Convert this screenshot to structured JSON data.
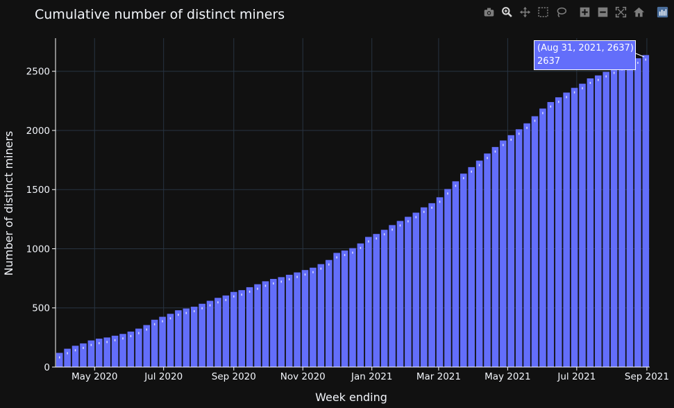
{
  "chart_data": {
    "type": "bar",
    "title": "Cumulative number of distinct miners",
    "xlabel": "Week ending",
    "ylabel": "Number of distinct miners",
    "ylim": [
      0,
      2780
    ],
    "yticks": [
      0,
      500,
      1000,
      1500,
      2000,
      2500
    ],
    "xtick_labels": [
      "May 2020",
      "Jul 2020",
      "Sep 2020",
      "Nov 2020",
      "Jan 2021",
      "Mar 2021",
      "May 2021",
      "Jul 2021",
      "Sep 2021"
    ],
    "xtick_dates": [
      "2020-05-01",
      "2020-07-01",
      "2020-09-01",
      "2020-11-01",
      "2021-01-01",
      "2021-03-01",
      "2021-05-01",
      "2021-07-01",
      "2021-09-01"
    ],
    "grid": true,
    "bar_color": "#636efa",
    "background": "#111111",
    "x": [
      "2020-03-31",
      "2020-04-07",
      "2020-04-14",
      "2020-04-21",
      "2020-04-28",
      "2020-05-05",
      "2020-05-12",
      "2020-05-19",
      "2020-05-26",
      "2020-06-02",
      "2020-06-09",
      "2020-06-16",
      "2020-06-23",
      "2020-06-30",
      "2020-07-07",
      "2020-07-14",
      "2020-07-21",
      "2020-07-28",
      "2020-08-04",
      "2020-08-11",
      "2020-08-18",
      "2020-08-25",
      "2020-09-01",
      "2020-09-08",
      "2020-09-15",
      "2020-09-22",
      "2020-09-29",
      "2020-10-06",
      "2020-10-13",
      "2020-10-20",
      "2020-10-27",
      "2020-11-03",
      "2020-11-10",
      "2020-11-17",
      "2020-11-24",
      "2020-12-01",
      "2020-12-08",
      "2020-12-15",
      "2020-12-22",
      "2020-12-29",
      "2021-01-05",
      "2021-01-12",
      "2021-01-19",
      "2021-01-26",
      "2021-02-02",
      "2021-02-09",
      "2021-02-16",
      "2021-02-23",
      "2021-03-02",
      "2021-03-09",
      "2021-03-16",
      "2021-03-23",
      "2021-03-30",
      "2021-04-06",
      "2021-04-13",
      "2021-04-20",
      "2021-04-27",
      "2021-05-04",
      "2021-05-11",
      "2021-05-18",
      "2021-05-25",
      "2021-06-01",
      "2021-06-08",
      "2021-06-15",
      "2021-06-22",
      "2021-06-29",
      "2021-07-06",
      "2021-07-13",
      "2021-07-20",
      "2021-07-27",
      "2021-08-03",
      "2021-08-10",
      "2021-08-17",
      "2021-08-24",
      "2021-08-31"
    ],
    "values": [
      120,
      155,
      180,
      200,
      225,
      240,
      250,
      265,
      280,
      300,
      325,
      355,
      400,
      425,
      450,
      480,
      495,
      510,
      535,
      560,
      585,
      605,
      635,
      650,
      675,
      700,
      725,
      745,
      760,
      780,
      800,
      820,
      840,
      870,
      905,
      965,
      985,
      1005,
      1045,
      1100,
      1125,
      1160,
      1200,
      1235,
      1270,
      1305,
      1350,
      1385,
      1435,
      1505,
      1570,
      1635,
      1690,
      1745,
      1805,
      1860,
      1915,
      1960,
      2010,
      2060,
      2120,
      2185,
      2240,
      2280,
      2320,
      2360,
      2395,
      2440,
      2465,
      2495,
      2525,
      2555,
      2575,
      2610,
      2637
    ]
  },
  "hover": {
    "line1": "(Aug 31, 2021, 2637)",
    "line2": "2637"
  },
  "modebar": {
    "buttons": [
      "camera-icon",
      "zoom-icon",
      "pan-icon",
      "box-select-icon",
      "lasso-icon",
      "zoom-in-icon",
      "zoom-out-icon",
      "autoscale-icon",
      "reset-axes-icon",
      "plotly-logo-icon"
    ]
  }
}
